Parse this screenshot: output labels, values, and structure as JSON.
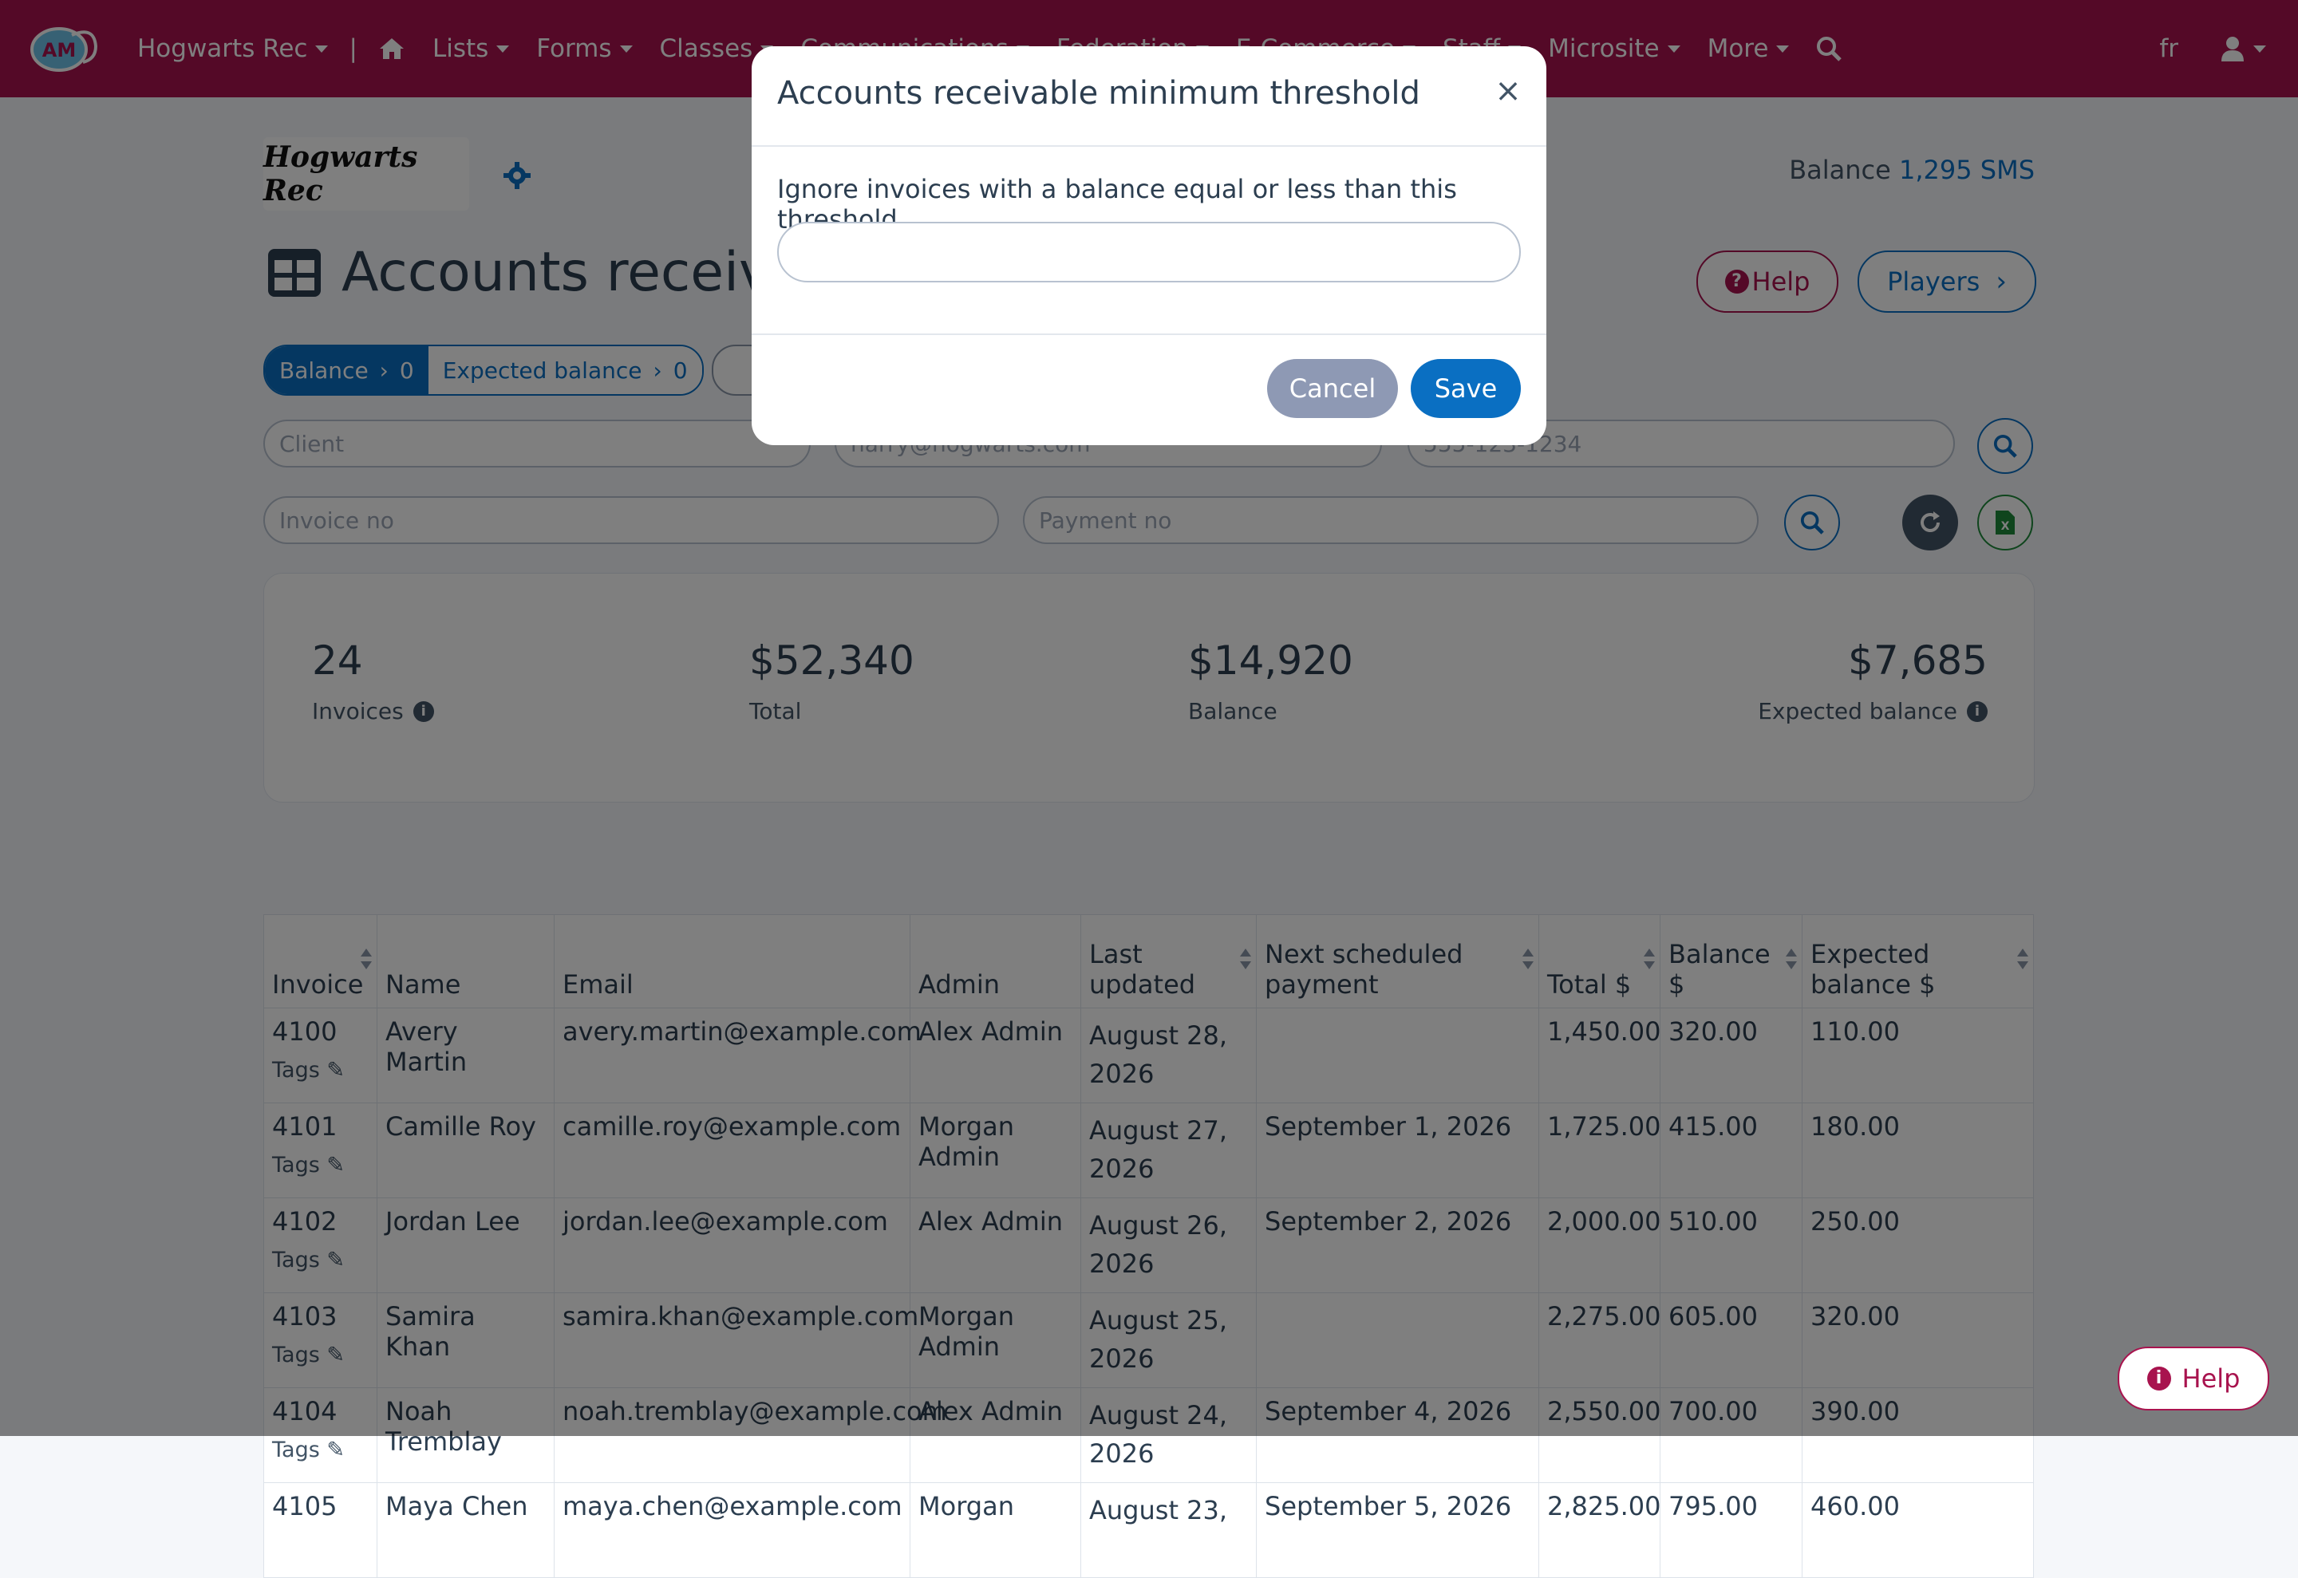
{
  "nav": {
    "org": "Hogwarts Rec",
    "items": [
      "Lists",
      "Forms",
      "Classes",
      "Communications",
      "Federation",
      "E-Commerce",
      "Staff",
      "Microsite",
      "More"
    ],
    "lang": "fr",
    "logo_text": "AM"
  },
  "header": {
    "club_logo_text": "Hogwarts Rec",
    "balance_label": "Balance",
    "balance_value": "1,295 SMS",
    "title": "Accounts receivab",
    "help_label": "Help",
    "players_label": "Players"
  },
  "filters": {
    "balance_pill": {
      "label": "Balance",
      "value": "0"
    },
    "expected_pill": {
      "label": "Expected balance",
      "value": "0"
    },
    "client_placeholder": "Client",
    "email_placeholder": "harry@hogwarts.com",
    "phone_placeholder": "555-123-1234",
    "invoice_placeholder": "Invoice no",
    "payment_placeholder": "Payment no"
  },
  "stats": {
    "invoices": {
      "value": "24",
      "label": "Invoices"
    },
    "total": {
      "value": "$52,340",
      "label": "Total"
    },
    "balance": {
      "value": "$14,920",
      "label": "Balance"
    },
    "expected": {
      "value": "$7,685",
      "label": "Expected balance"
    }
  },
  "table": {
    "headers": [
      "Invoice",
      "Name",
      "Email",
      "Admin",
      "Last updated",
      "Next scheduled payment",
      "Total $",
      "Balance $",
      "Expected balance $"
    ],
    "tags_label": "Tags",
    "rows": [
      {
        "invoice": "4100",
        "name": "Avery Martin",
        "email": "avery.martin@example.com",
        "admin": "Alex Admin",
        "updated": "August 28, 2026",
        "next": "",
        "total": "1,450.00",
        "balance": "320.00",
        "expected": "110.00"
      },
      {
        "invoice": "4101",
        "name": "Camille Roy",
        "email": "camille.roy@example.com",
        "admin": "Morgan Admin",
        "updated": "August 27, 2026",
        "next": "September 1, 2026",
        "total": "1,725.00",
        "balance": "415.00",
        "expected": "180.00"
      },
      {
        "invoice": "4102",
        "name": "Jordan Lee",
        "email": "jordan.lee@example.com",
        "admin": "Alex Admin",
        "updated": "August 26, 2026",
        "next": "September 2, 2026",
        "total": "2,000.00",
        "balance": "510.00",
        "expected": "250.00"
      },
      {
        "invoice": "4103",
        "name": "Samira Khan",
        "email": "samira.khan@example.com",
        "admin": "Morgan Admin",
        "updated": "August 25, 2026",
        "next": "",
        "total": "2,275.00",
        "balance": "605.00",
        "expected": "320.00"
      },
      {
        "invoice": "4104",
        "name": "Noah Tremblay",
        "email": "noah.tremblay@example.com",
        "admin": "Alex Admin",
        "updated": "August 24, 2026",
        "next": "September 4, 2026",
        "total": "2,550.00",
        "balance": "700.00",
        "expected": "390.00"
      },
      {
        "invoice": "4105",
        "name": "Maya Chen",
        "email": "maya.chen@example.com",
        "admin": "Morgan",
        "updated": "August 23,",
        "next": "September 5, 2026",
        "total": "2,825.00",
        "balance": "795.00",
        "expected": "460.00"
      }
    ]
  },
  "modal": {
    "title": "Accounts receivable minimum threshold",
    "description": "Ignore invoices with a balance equal or less than this threshold.",
    "input_value": "",
    "cancel_label": "Cancel",
    "save_label": "Save"
  },
  "float_help_label": "Help",
  "colors": {
    "brand": "#a8134e",
    "primary": "#0a6fc2",
    "muted_button": "#8e99b4"
  }
}
